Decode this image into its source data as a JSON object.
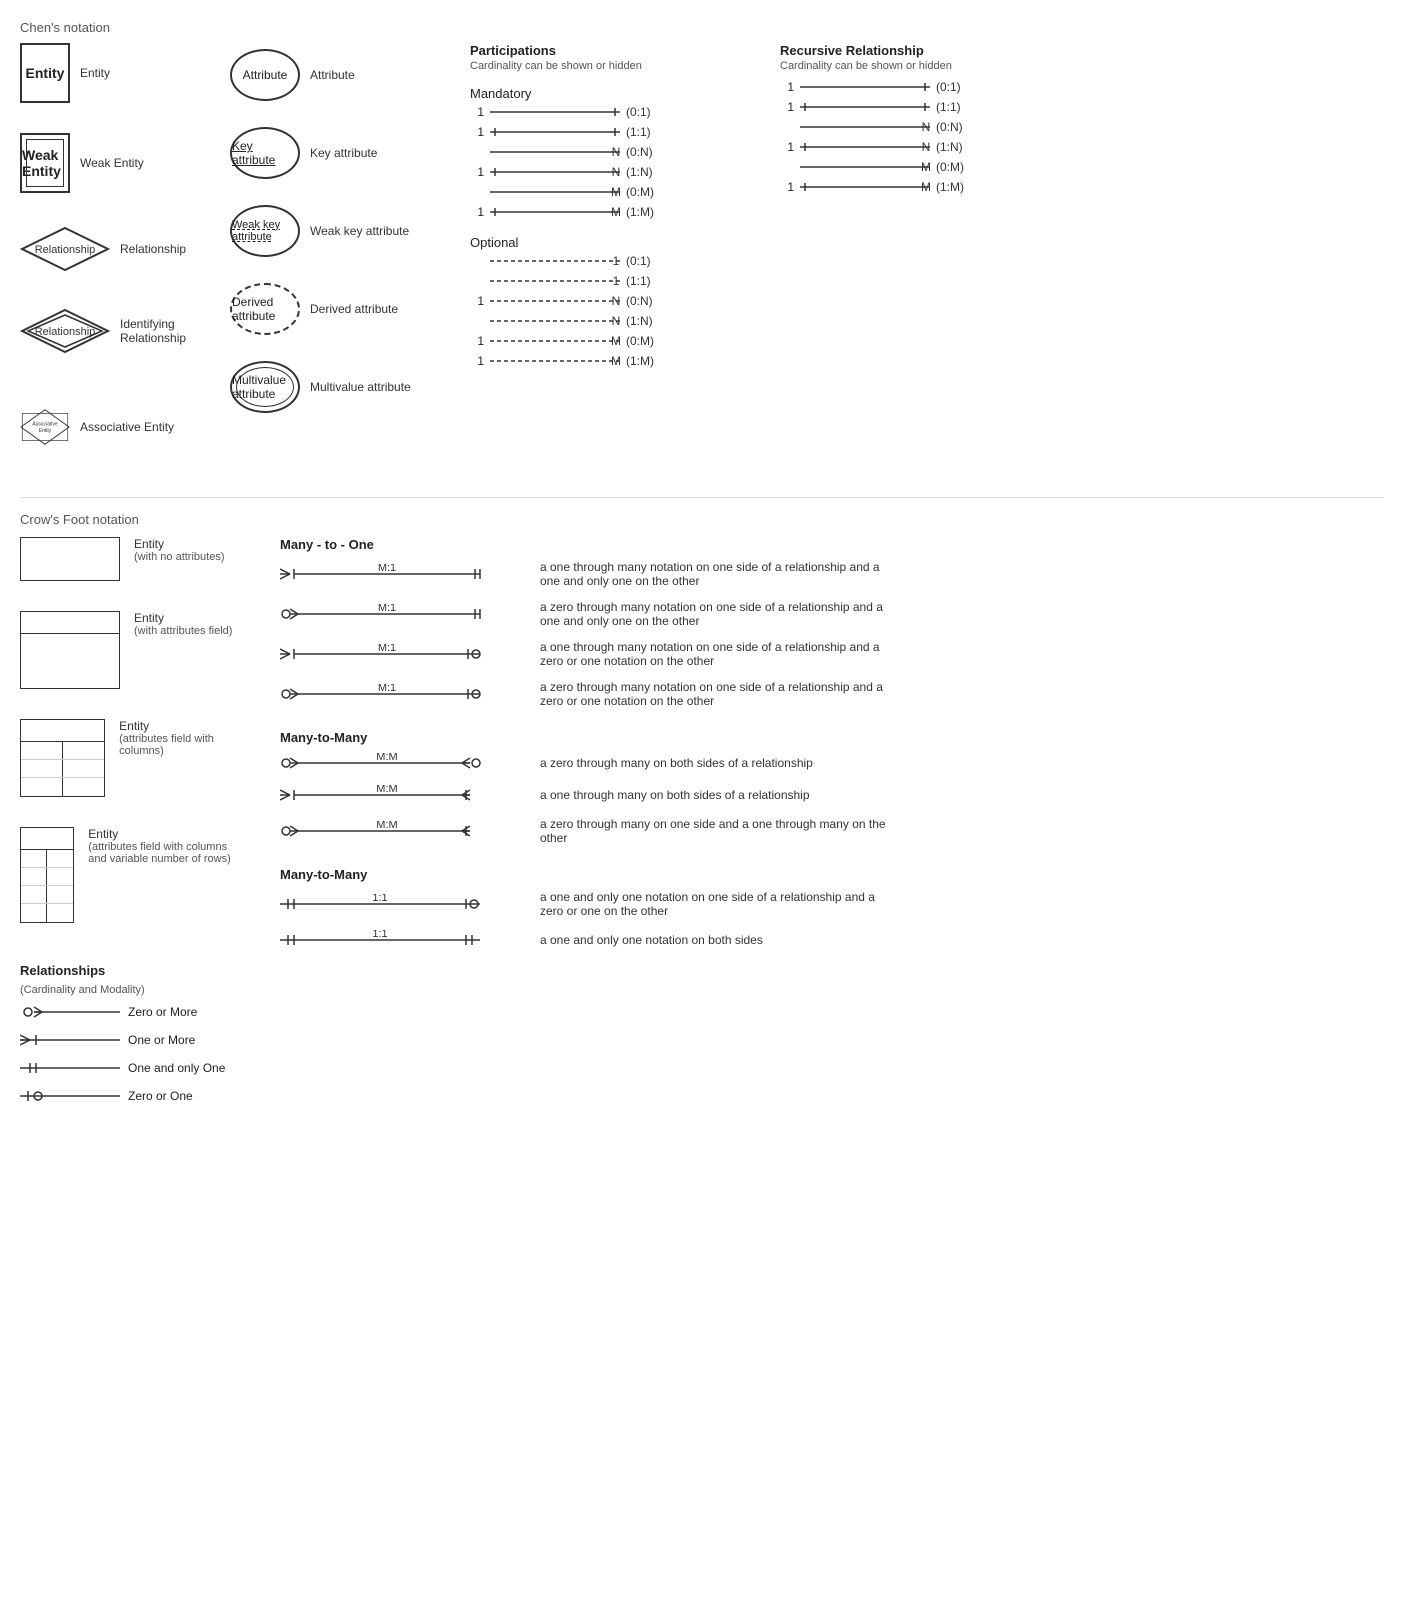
{
  "chen": {
    "header": "Chen's notation",
    "shapes": [
      {
        "id": "entity",
        "label": "Entity",
        "desc": "Entity"
      },
      {
        "id": "weak-entity",
        "label": "Weak Entity",
        "desc": "Weak Entity"
      },
      {
        "id": "relationship",
        "label": "Relationship",
        "desc": "Relationship"
      },
      {
        "id": "identifying-relationship",
        "label": "Relationship",
        "desc": "Identifying Relationship"
      },
      {
        "id": "associative-entity",
        "label": "Associative Entity",
        "desc": "Associative Entity"
      }
    ],
    "attributes": [
      {
        "id": "attribute",
        "label": "Attribute",
        "desc": "Attribute",
        "type": "normal"
      },
      {
        "id": "key-attribute",
        "label": "Key attribute",
        "desc": "Key attribute",
        "type": "key"
      },
      {
        "id": "weak-key-attribute",
        "label": "Weak key attribute",
        "desc": "Weak key attribute",
        "type": "weakkey"
      },
      {
        "id": "derived-attribute",
        "label": "Derived attribute",
        "desc": "Derived attribute",
        "type": "derived"
      },
      {
        "id": "multivalue-attribute",
        "label": "Multivalue attribute",
        "desc": "Multivalue attribute",
        "type": "multivalue"
      }
    ]
  },
  "participations": {
    "header": "Participations",
    "subheader": "Cardinality can be shown or hidden",
    "mandatory_label": "Mandatory",
    "optional_label": "Optional",
    "mandatory_rows": [
      {
        "left": "1",
        "right": "1",
        "notation": "(0:1)"
      },
      {
        "left": "1",
        "right": "1",
        "notation": "(1:1)"
      },
      {
        "left": "",
        "right": "N",
        "notation": "(0:N)"
      },
      {
        "left": "1",
        "right": "N",
        "notation": "(1:N)"
      },
      {
        "left": "",
        "right": "M",
        "notation": "(0:M)"
      },
      {
        "left": "1",
        "right": "M",
        "notation": "(1:M)"
      }
    ],
    "optional_rows": [
      {
        "left": "",
        "right": "1",
        "notation": "(0:1)"
      },
      {
        "left": "",
        "right": "1",
        "notation": "(1:1)"
      },
      {
        "left": "1",
        "right": "N",
        "notation": "(0:N)"
      },
      {
        "left": "",
        "right": "N",
        "notation": "(1:N)"
      },
      {
        "left": "1",
        "right": "M",
        "notation": "(0:M)"
      },
      {
        "left": "1",
        "right": "M",
        "notation": "(1:M)"
      }
    ]
  },
  "recursive": {
    "header": "Recursive Relationship",
    "subheader": "Cardinality can be shown or hidden",
    "rows": [
      {
        "left": "1",
        "right": "1",
        "notation": "(0:1)"
      },
      {
        "left": "1",
        "right": "1",
        "notation": "(1:1)"
      },
      {
        "left": "",
        "right": "N",
        "notation": "(0:N)"
      },
      {
        "left": "1",
        "right": "N",
        "notation": "(1:N)"
      },
      {
        "left": "",
        "right": "M",
        "notation": "(0:M)"
      },
      {
        "left": "1",
        "right": "M",
        "notation": "(1:M)"
      }
    ]
  },
  "crows": {
    "header": "Crow's Foot notation",
    "entities": [
      {
        "id": "entity-no-attr",
        "label": "Entity",
        "sublabel": "(with no attributes)",
        "type": "simple"
      },
      {
        "id": "entity-attr",
        "label": "Entity",
        "sublabel": "(with attributes field)",
        "type": "attr"
      },
      {
        "id": "entity-attr-cols",
        "label": "Entity",
        "sublabel": "(attributes field with columns)",
        "type": "attr-cols"
      },
      {
        "id": "entity-attr-rows",
        "label": "Entity",
        "sublabel": "(attributes field with columns and variable number of rows)",
        "type": "attr-rows"
      }
    ],
    "legend": {
      "header": "Relationships",
      "subheader": "(Cardinality and Modality)",
      "items": [
        {
          "symbol": "zero-or-more",
          "label": "Zero or More"
        },
        {
          "symbol": "one-or-more",
          "label": "One or More"
        },
        {
          "symbol": "one-and-only-one",
          "label": "One and only One"
        },
        {
          "symbol": "zero-or-one",
          "label": "Zero or One"
        }
      ]
    },
    "many_to_one": {
      "header": "Many - to - One",
      "rows": [
        {
          "label": "M:1",
          "desc": "a one through many notation on one side of a relationship and a one and only one on the other",
          "left_symbol": "many-one",
          "right_symbol": "one-only"
        },
        {
          "label": "M:1",
          "desc": "a zero through many notation on one side of a relationship and a one and only one on the other",
          "left_symbol": "many-zero",
          "right_symbol": "one-only"
        },
        {
          "label": "M:1",
          "desc": "a one through many notation on one side of a relationship and a zero or one notation on the other",
          "left_symbol": "many-one",
          "right_symbol": "zero-one"
        },
        {
          "label": "M:1",
          "desc": "a zero through many notation on one side of a relationship and a zero or one notation on the other",
          "left_symbol": "many-zero",
          "right_symbol": "zero-one"
        }
      ]
    },
    "many_to_many": {
      "header": "Many-to-Many",
      "rows": [
        {
          "label": "M:M",
          "desc": "a zero through many on both sides of a relationship",
          "left_symbol": "many-zero",
          "right_symbol": "many-zero-r"
        },
        {
          "label": "M:M",
          "desc": "a one through many on both sides of a relationship",
          "left_symbol": "many-one",
          "right_symbol": "many-one-r"
        },
        {
          "label": "M:M",
          "desc": "a zero through many on one side and a one through many on the other",
          "left_symbol": "many-zero",
          "right_symbol": "many-one-r"
        }
      ]
    },
    "one_to_one": {
      "header": "Many-to-Many",
      "rows": [
        {
          "label": "1:1",
          "desc": "a one and only one notation on one side of a relationship and a zero or one on the other",
          "left_symbol": "one-only-l",
          "right_symbol": "zero-one-r"
        },
        {
          "label": "1:1",
          "desc": "a one and only one notation on both sides",
          "left_symbol": "one-only-l",
          "right_symbol": "one-only-r"
        }
      ]
    }
  }
}
